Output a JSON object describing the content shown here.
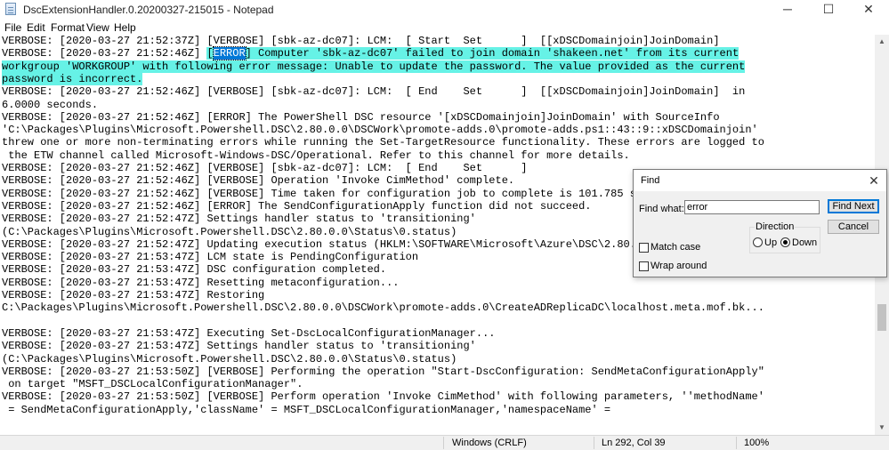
{
  "window": {
    "title": "DscExtensionHandler.0.20200327-215015 - Notepad",
    "minimize": "─",
    "maximize": "☐",
    "close": "✕"
  },
  "menu": [
    "File",
    "Edit",
    "Format",
    "View",
    "Help"
  ],
  "editor": {
    "lines": [
      [
        {
          "t": "VERBOSE: [2020-03-27 21:52:37Z] [VERBOSE] [sbk-az-dc07]: LCM:  [ Start  Set      ]  [[xDSCDomainjoin]JoinDomain]"
        }
      ],
      [
        {
          "t": "VERBOSE: [2020-03-27 21:52:46Z] "
        },
        {
          "t": "[",
          "c": "hl"
        },
        {
          "t": "ERROR",
          "c": "sel"
        },
        {
          "t": "] Computer 'sbk-az-dc07' failed to join domain 'shakeen.net' from its current",
          "c": "hl"
        }
      ],
      [
        {
          "t": "workgroup 'WORKGROUP' with following error message: Unable to update the password. The value provided as the current",
          "c": "hl"
        }
      ],
      [
        {
          "t": "password is incorrect.",
          "c": "hl"
        }
      ],
      [
        {
          "t": "VERBOSE: [2020-03-27 21:52:46Z] [VERBOSE] [sbk-az-dc07]: LCM:  [ End    Set      ]  [[xDSCDomainjoin]JoinDomain]  in"
        }
      ],
      [
        {
          "t": "6.0000 seconds."
        }
      ],
      [
        {
          "t": "VERBOSE: [2020-03-27 21:52:46Z] [ERROR] The PowerShell DSC resource '[xDSCDomainjoin]JoinDomain' with SourceInfo"
        }
      ],
      [
        {
          "t": "'C:\\Packages\\Plugins\\Microsoft.Powershell.DSC\\2.80.0.0\\DSCWork\\promote-adds.0\\promote-adds.ps1::43::9::xDSCDomainjoin'"
        }
      ],
      [
        {
          "t": "threw one or more non-terminating errors while running the Set-TargetResource functionality. These errors are logged to"
        }
      ],
      [
        {
          "t": " the ETW channel called Microsoft-Windows-DSC/Operational. Refer to this channel for more details."
        }
      ],
      [
        {
          "t": "VERBOSE: [2020-03-27 21:52:46Z] [VERBOSE] [sbk-az-dc07]: LCM:  [ End    Set      ]"
        }
      ],
      [
        {
          "t": "VERBOSE: [2020-03-27 21:52:46Z] [VERBOSE] Operation 'Invoke CimMethod' complete."
        }
      ],
      [
        {
          "t": "VERBOSE: [2020-03-27 21:52:46Z] [VERBOSE] Time taken for configuration job to complete is 101.785 seconds"
        }
      ],
      [
        {
          "t": "VERBOSE: [2020-03-27 21:52:46Z] [ERROR] The SendConfigurationApply function did not succeed."
        }
      ],
      [
        {
          "t": "VERBOSE: [2020-03-27 21:52:47Z] Settings handler status to 'transitioning'"
        }
      ],
      [
        {
          "t": "(C:\\Packages\\Plugins\\Microsoft.Powershell.DSC\\2.80.0.0\\Status\\0.status)"
        }
      ],
      [
        {
          "t": "VERBOSE: [2020-03-27 21:52:47Z] Updating execution status (HKLM:\\SOFTWARE\\Microsoft\\Azure\\DSC\\2.80.0.0\\Status)"
        }
      ],
      [
        {
          "t": "VERBOSE: [2020-03-27 21:53:47Z] LCM state is PendingConfiguration"
        }
      ],
      [
        {
          "t": "VERBOSE: [2020-03-27 21:53:47Z] DSC configuration completed."
        }
      ],
      [
        {
          "t": "VERBOSE: [2020-03-27 21:53:47Z] Resetting metaconfiguration..."
        }
      ],
      [
        {
          "t": "VERBOSE: [2020-03-27 21:53:47Z] Restoring"
        }
      ],
      [
        {
          "t": "C:\\Packages\\Plugins\\Microsoft.Powershell.DSC\\2.80.0.0\\DSCWork\\promote-adds.0\\CreateADReplicaDC\\localhost.meta.mof.bk..."
        }
      ],
      [
        {
          "t": ""
        }
      ],
      [
        {
          "t": "VERBOSE: [2020-03-27 21:53:47Z] Executing Set-DscLocalConfigurationManager..."
        }
      ],
      [
        {
          "t": "VERBOSE: [2020-03-27 21:53:47Z] Settings handler status to 'transitioning'"
        }
      ],
      [
        {
          "t": "(C:\\Packages\\Plugins\\Microsoft.Powershell.DSC\\2.80.0.0\\Status\\0.status)"
        }
      ],
      [
        {
          "t": "VERBOSE: [2020-03-27 21:53:50Z] [VERBOSE] Performing the operation \"Start-DscConfiguration: SendMetaConfigurationApply\""
        }
      ],
      [
        {
          "t": " on target \"MSFT_DSCLocalConfigurationManager\"."
        }
      ],
      [
        {
          "t": "VERBOSE: [2020-03-27 21:53:50Z] [VERBOSE] Perform operation 'Invoke CimMethod' with following parameters, ''methodName'"
        }
      ],
      [
        {
          "t": " = SendMetaConfigurationApply,'className' = MSFT_DSCLocalConfigurationManager,'namespaceName' ="
        }
      ]
    ]
  },
  "status_bar": {
    "line_ending": "Windows (CRLF)",
    "position": "Ln 292, Col 39",
    "zoom": "100%"
  },
  "find_dialog": {
    "title": "Find",
    "find_what_label": "Find what:",
    "find_what_value": "error",
    "find_next_label": "Find Next",
    "cancel_label": "Cancel",
    "direction_label": "Direction",
    "up_label": "Up",
    "down_label": "Down",
    "direction_selected": "Down",
    "match_case_label": "Match case",
    "match_case_checked": false,
    "wrap_around_label": "Wrap around",
    "wrap_around_checked": false,
    "close": "✕"
  }
}
